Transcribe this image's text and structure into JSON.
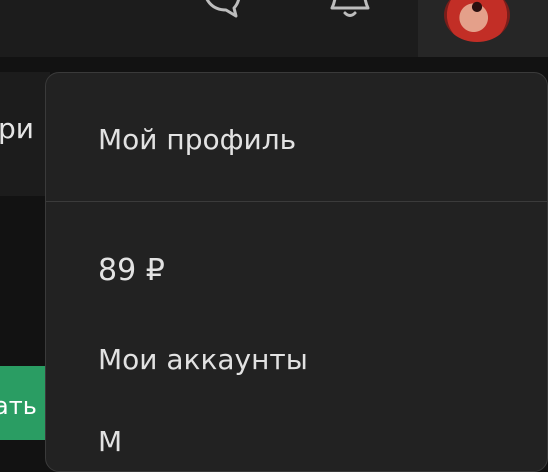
{
  "header": {
    "chat_icon": "chat-bubble-icon",
    "notifications_icon": "bell-icon",
    "avatar_icon": "user-avatar"
  },
  "background": {
    "left_panel_text": "ри",
    "green_button_label": "ать"
  },
  "dropdown": {
    "items": [
      {
        "label": "Мой профиль"
      },
      {
        "label": "89 ₽"
      },
      {
        "label": "Мои аккаунты"
      },
      {
        "label": "М"
      }
    ]
  },
  "colors": {
    "background": "#121212",
    "surface": "#1c1c1c",
    "dropdown": "#222222",
    "accent_green": "#2a9d63"
  }
}
